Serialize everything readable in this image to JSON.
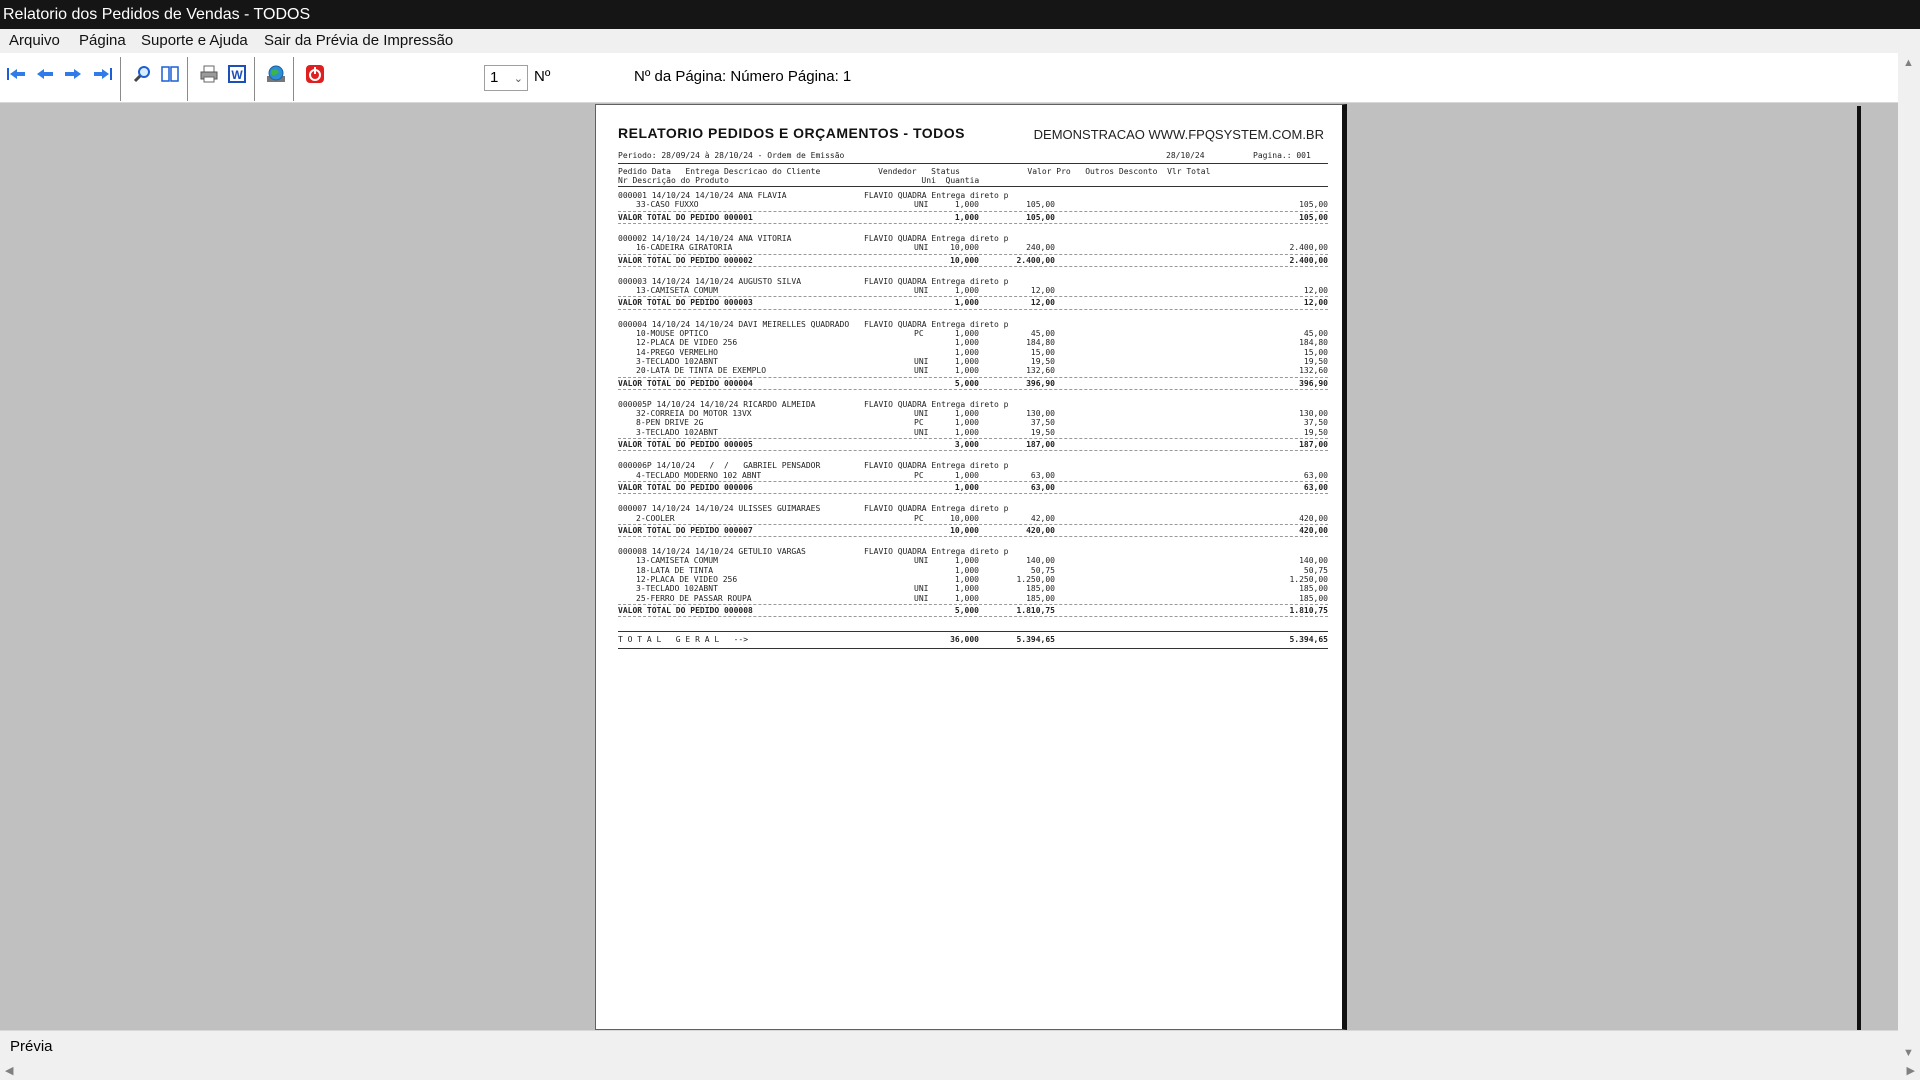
{
  "window": {
    "title": "Relatorio dos Pedidos de Vendas - TODOS"
  },
  "menu": {
    "arquivo": "Arquivo",
    "pagina": "Página",
    "suporte": "Suporte e Ajuda",
    "sair": "Sair da Prévia de Impressão"
  },
  "toolbar": {
    "page_value": "1",
    "num_label": "Nº",
    "page_info": "Nº da Página: Número Página: 1",
    "icons": [
      "first-page-icon",
      "previous-page-icon",
      "next-page-icon",
      "last-page-icon",
      "zoom-icon",
      "two-page-icon",
      "print-icon",
      "word-export-icon",
      "web-export-icon",
      "close-preview-icon"
    ]
  },
  "status": {
    "text": "Prévia"
  },
  "report": {
    "title": "RELATORIO PEDIDOS E ORÇAMENTOS - TODOS",
    "site": "DEMONSTRACAO WWW.FPQSYSTEM.COM.BR",
    "period": "Periodo: 28/09/24 à 28/10/24 - Ordem de Emissão",
    "date": "28/10/24",
    "page": "Pagina.: 001",
    "header1": "Pedido Data   Entrega Descricao do Cliente            Vendedor   Status              Valor Pro   Outros Desconto  Vlr Total",
    "header2": "Nr Descrição do Produto                                        Uni  Quantia",
    "orders": [
      {
        "head": "000001 14/10/24 14/10/24 ANA FLAVIA",
        "seller": "FLAVIO QUADRA Entrega direto p",
        "items": [
          [
            "33-CASO FUXXO",
            "UNI",
            "1,000",
            "105,00",
            "105,00"
          ]
        ],
        "total_label": "VALOR TOTAL DO PEDIDO 000001",
        "total_qty": "1,000",
        "total_price": "105,00",
        "total_value": "105,00"
      },
      {
        "head": "000002 14/10/24 14/10/24 ANA VITORIA",
        "seller": "FLAVIO QUADRA Entrega direto p",
        "items": [
          [
            "16-CADEIRA GIRATORIA",
            "UNI",
            "10,000",
            "240,00",
            "2.400,00"
          ]
        ],
        "total_label": "VALOR TOTAL DO PEDIDO 000002",
        "total_qty": "10,000",
        "total_price": "2.400,00",
        "total_value": "2.400,00"
      },
      {
        "head": "000003 14/10/24 14/10/24 AUGUSTO SILVA",
        "seller": "FLAVIO QUADRA Entrega direto p",
        "items": [
          [
            "13-CAMISETA COMUM",
            "UNI",
            "1,000",
            "12,00",
            "12,00"
          ]
        ],
        "total_label": "VALOR TOTAL DO PEDIDO 000003",
        "total_qty": "1,000",
        "total_price": "12,00",
        "total_value": "12,00"
      },
      {
        "head": "000004 14/10/24 14/10/24 DAVI MEIRELLES QUADRADO",
        "seller": "FLAVIO QUADRA Entrega direto p",
        "items": [
          [
            "10-MOUSE OPTICO",
            "PC",
            "1,000",
            "45,00",
            "45,00"
          ],
          [
            "12-PLACA DE VIDEO 256",
            "",
            "1,000",
            "184,80",
            "184,80"
          ],
          [
            "14-PREGO VERMELHO",
            "",
            "1,000",
            "15,00",
            "15,00"
          ],
          [
            "3-TECLADO 102ABNT",
            "UNI",
            "1,000",
            "19,50",
            "19,50"
          ],
          [
            "20-LATA DE TINTA DE EXEMPLO",
            "UNI",
            "1,000",
            "132,60",
            "132,60"
          ]
        ],
        "total_label": "VALOR TOTAL DO PEDIDO 000004",
        "total_qty": "5,000",
        "total_price": "396,90",
        "total_value": "396,90"
      },
      {
        "head": "000005P 14/10/24 14/10/24 RICARDO ALMEIDA",
        "seller": "FLAVIO QUADRA Entrega direto p",
        "items": [
          [
            "32-CORREIA DO MOTOR 13VX",
            "UNI",
            "1,000",
            "130,00",
            "130,00"
          ],
          [
            "8-PEN DRIVE 2G",
            "PC",
            "1,000",
            "37,50",
            "37,50"
          ],
          [
            "3-TECLADO 102ABNT",
            "UNI",
            "1,000",
            "19,50",
            "19,50"
          ]
        ],
        "total_label": "VALOR TOTAL DO PEDIDO 000005",
        "total_qty": "3,000",
        "total_price": "187,00",
        "total_value": "187,00"
      },
      {
        "head": "000006P 14/10/24   /  /   GABRIEL PENSADOR",
        "seller": "FLAVIO QUADRA Entrega direto p",
        "items": [
          [
            "4-TECLADO MODERNO 102 ABNT",
            "PC",
            "1,000",
            "63,00",
            "63,00"
          ]
        ],
        "total_label": "VALOR TOTAL DO PEDIDO 000006",
        "total_qty": "1,000",
        "total_price": "63,00",
        "total_value": "63,00"
      },
      {
        "head": "000007 14/10/24 14/10/24 ULISSES GUIMARAES",
        "seller": "FLAVIO QUADRA Entrega direto p",
        "items": [
          [
            "2-COOLER",
            "PC",
            "10,000",
            "42,00",
            "420,00"
          ]
        ],
        "total_label": "VALOR TOTAL DO PEDIDO 000007",
        "total_qty": "10,000",
        "total_price": "420,00",
        "total_value": "420,00"
      },
      {
        "head": "000008 14/10/24 14/10/24 GETULIO VARGAS",
        "seller": "FLAVIO QUADRA Entrega direto p",
        "items": [
          [
            "13-CAMISETA COMUM",
            "UNI",
            "1,000",
            "140,00",
            "140,00"
          ],
          [
            "18-LATA DE TINTA",
            "",
            "1,000",
            "50,75",
            "50,75"
          ],
          [
            "12-PLACA DE VIDEO 256",
            "",
            "1,000",
            "1.250,00",
            "1.250,00"
          ],
          [
            "3-TECLADO 102ABNT",
            "UNI",
            "1,000",
            "185,00",
            "185,00"
          ],
          [
            "25-FERRO DE PASSAR ROUPA",
            "UNI",
            "1,000",
            "185,00",
            "185,00"
          ]
        ],
        "total_label": "VALOR TOTAL DO PEDIDO 000008",
        "total_qty": "5,000",
        "total_price": "1.810,75",
        "total_value": "1.810,75"
      }
    ],
    "grand_label": "T O T A L   G E R A L   -->",
    "grand_qty": "36,000",
    "grand_price": "5.394,65",
    "grand_value": "5.394,65"
  }
}
